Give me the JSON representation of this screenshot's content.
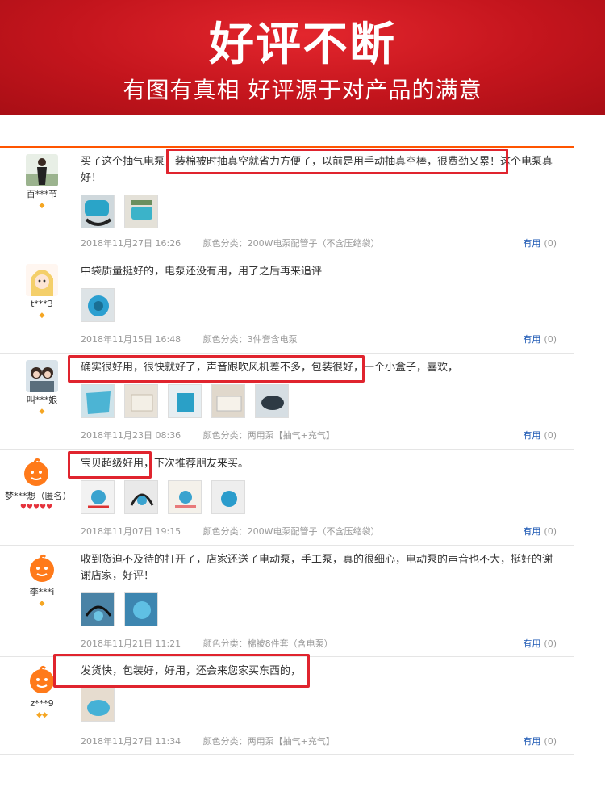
{
  "banner": {
    "title": "好评不断",
    "subtitle": "有图有真相 好评源于对产品的满意"
  },
  "useful_label": "有用",
  "useful_count": "(0)",
  "reviews": [
    {
      "user": "百***节",
      "text": "买了这个抽气电泵，装棉被时抽真空就省力方便了，以前是用手动抽真空棒，很费劲又累！这个电泵真好！",
      "date": "2018年11月27日 16:26",
      "sku": "颜色分类：200W电泵配管子（不含压缩袋）"
    },
    {
      "user": "t***3",
      "text": "中袋质量挺好的，电泵还没有用，用了之后再来追评",
      "date": "2018年11月15日 16:48",
      "sku": "颜色分类：3件套含电泵"
    },
    {
      "user": "叫***娘",
      "text": "确实很好用，很快就好了，声音跟吹风机差不多，包装很好，一个小盒子，喜欢，",
      "date": "2018年11月23日 08:36",
      "sku": "颜色分类：两用泵【抽气+充气】"
    },
    {
      "user": "梦***想（匿名）",
      "text": "宝贝超级好用，下次推荐朋友来买。",
      "date": "2018年11月07日 19:15",
      "sku": "颜色分类：200W电泵配管子（不含压缩袋）"
    },
    {
      "user": "李***i",
      "text": "收到货迫不及待的打开了，店家还送了电动泵，手工泵，真的很细心，电动泵的声音也不大，挺好的谢谢店家，好评！",
      "date": "2018年11月21日 11:21",
      "sku": "颜色分类：棉被8件套（含电泵）"
    },
    {
      "user": "z***9",
      "text": "发货快，包装好，好用，还会来您家买东西的，",
      "date": "2018年11月27日 11:34",
      "sku": "颜色分类：两用泵【抽气+充气】"
    }
  ],
  "colors": {
    "banner_red": "#c4151d",
    "highlight_red": "#e0242e",
    "accent_orange": "#ff5500",
    "link_blue": "#1e59b4"
  }
}
